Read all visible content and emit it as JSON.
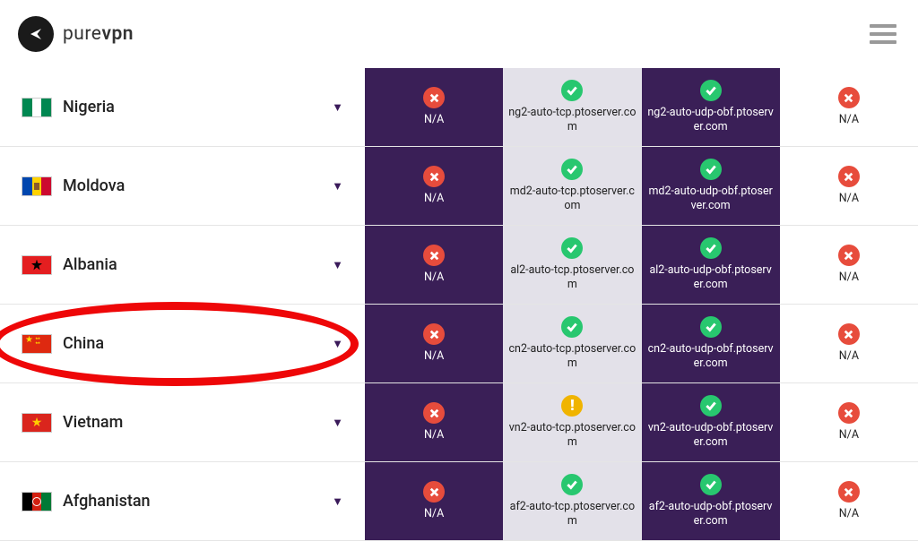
{
  "brand": {
    "pre": "pure",
    "bold": "vpn"
  },
  "na": "N/A",
  "rows": [
    {
      "country": "Nigeria",
      "flag": "ng",
      "cols": [
        {
          "status": "fail",
          "text": "N/A",
          "bg": "dark"
        },
        {
          "status": "ok",
          "text": "ng2-auto-tcp.ptoserver.com",
          "bg": "light"
        },
        {
          "status": "ok",
          "text": "ng2-auto-udp-obf.ptoserver.com",
          "bg": "dark"
        },
        {
          "status": "fail",
          "text": "N/A",
          "bg": "white"
        }
      ]
    },
    {
      "country": "Moldova",
      "flag": "md",
      "cols": [
        {
          "status": "fail",
          "text": "N/A",
          "bg": "dark"
        },
        {
          "status": "ok",
          "text": "md2-auto-tcp.ptoserver.com",
          "bg": "light"
        },
        {
          "status": "ok",
          "text": "md2-auto-udp-obf.ptoserver.com",
          "bg": "dark"
        },
        {
          "status": "fail",
          "text": "N/A",
          "bg": "white"
        }
      ]
    },
    {
      "country": "Albania",
      "flag": "al",
      "cols": [
        {
          "status": "fail",
          "text": "N/A",
          "bg": "dark"
        },
        {
          "status": "ok",
          "text": "al2-auto-tcp.ptoserver.com",
          "bg": "light"
        },
        {
          "status": "ok",
          "text": "al2-auto-udp-obf.ptoserver.com",
          "bg": "dark"
        },
        {
          "status": "fail",
          "text": "N/A",
          "bg": "white"
        }
      ]
    },
    {
      "country": "China",
      "flag": "cn",
      "highlighted": true,
      "cols": [
        {
          "status": "fail",
          "text": "N/A",
          "bg": "dark"
        },
        {
          "status": "ok",
          "text": "cn2-auto-tcp.ptoserver.com",
          "bg": "light"
        },
        {
          "status": "ok",
          "text": "cn2-auto-udp-obf.ptoserver.com",
          "bg": "dark"
        },
        {
          "status": "fail",
          "text": "N/A",
          "bg": "white"
        }
      ]
    },
    {
      "country": "Vietnam",
      "flag": "vn",
      "cols": [
        {
          "status": "fail",
          "text": "N/A",
          "bg": "dark"
        },
        {
          "status": "warn",
          "text": "vn2-auto-tcp.ptoserver.com",
          "bg": "light"
        },
        {
          "status": "ok",
          "text": "vn2-auto-udp-obf.ptoserver.com",
          "bg": "dark"
        },
        {
          "status": "fail",
          "text": "N/A",
          "bg": "white"
        }
      ]
    },
    {
      "country": "Afghanistan",
      "flag": "af",
      "cols": [
        {
          "status": "fail",
          "text": "N/A",
          "bg": "dark"
        },
        {
          "status": "ok",
          "text": "af2-auto-tcp.ptoserver.com",
          "bg": "light"
        },
        {
          "status": "ok",
          "text": "af2-auto-udp-obf.ptoserver.com",
          "bg": "dark"
        },
        {
          "status": "fail",
          "text": "N/A",
          "bg": "white"
        }
      ]
    }
  ]
}
